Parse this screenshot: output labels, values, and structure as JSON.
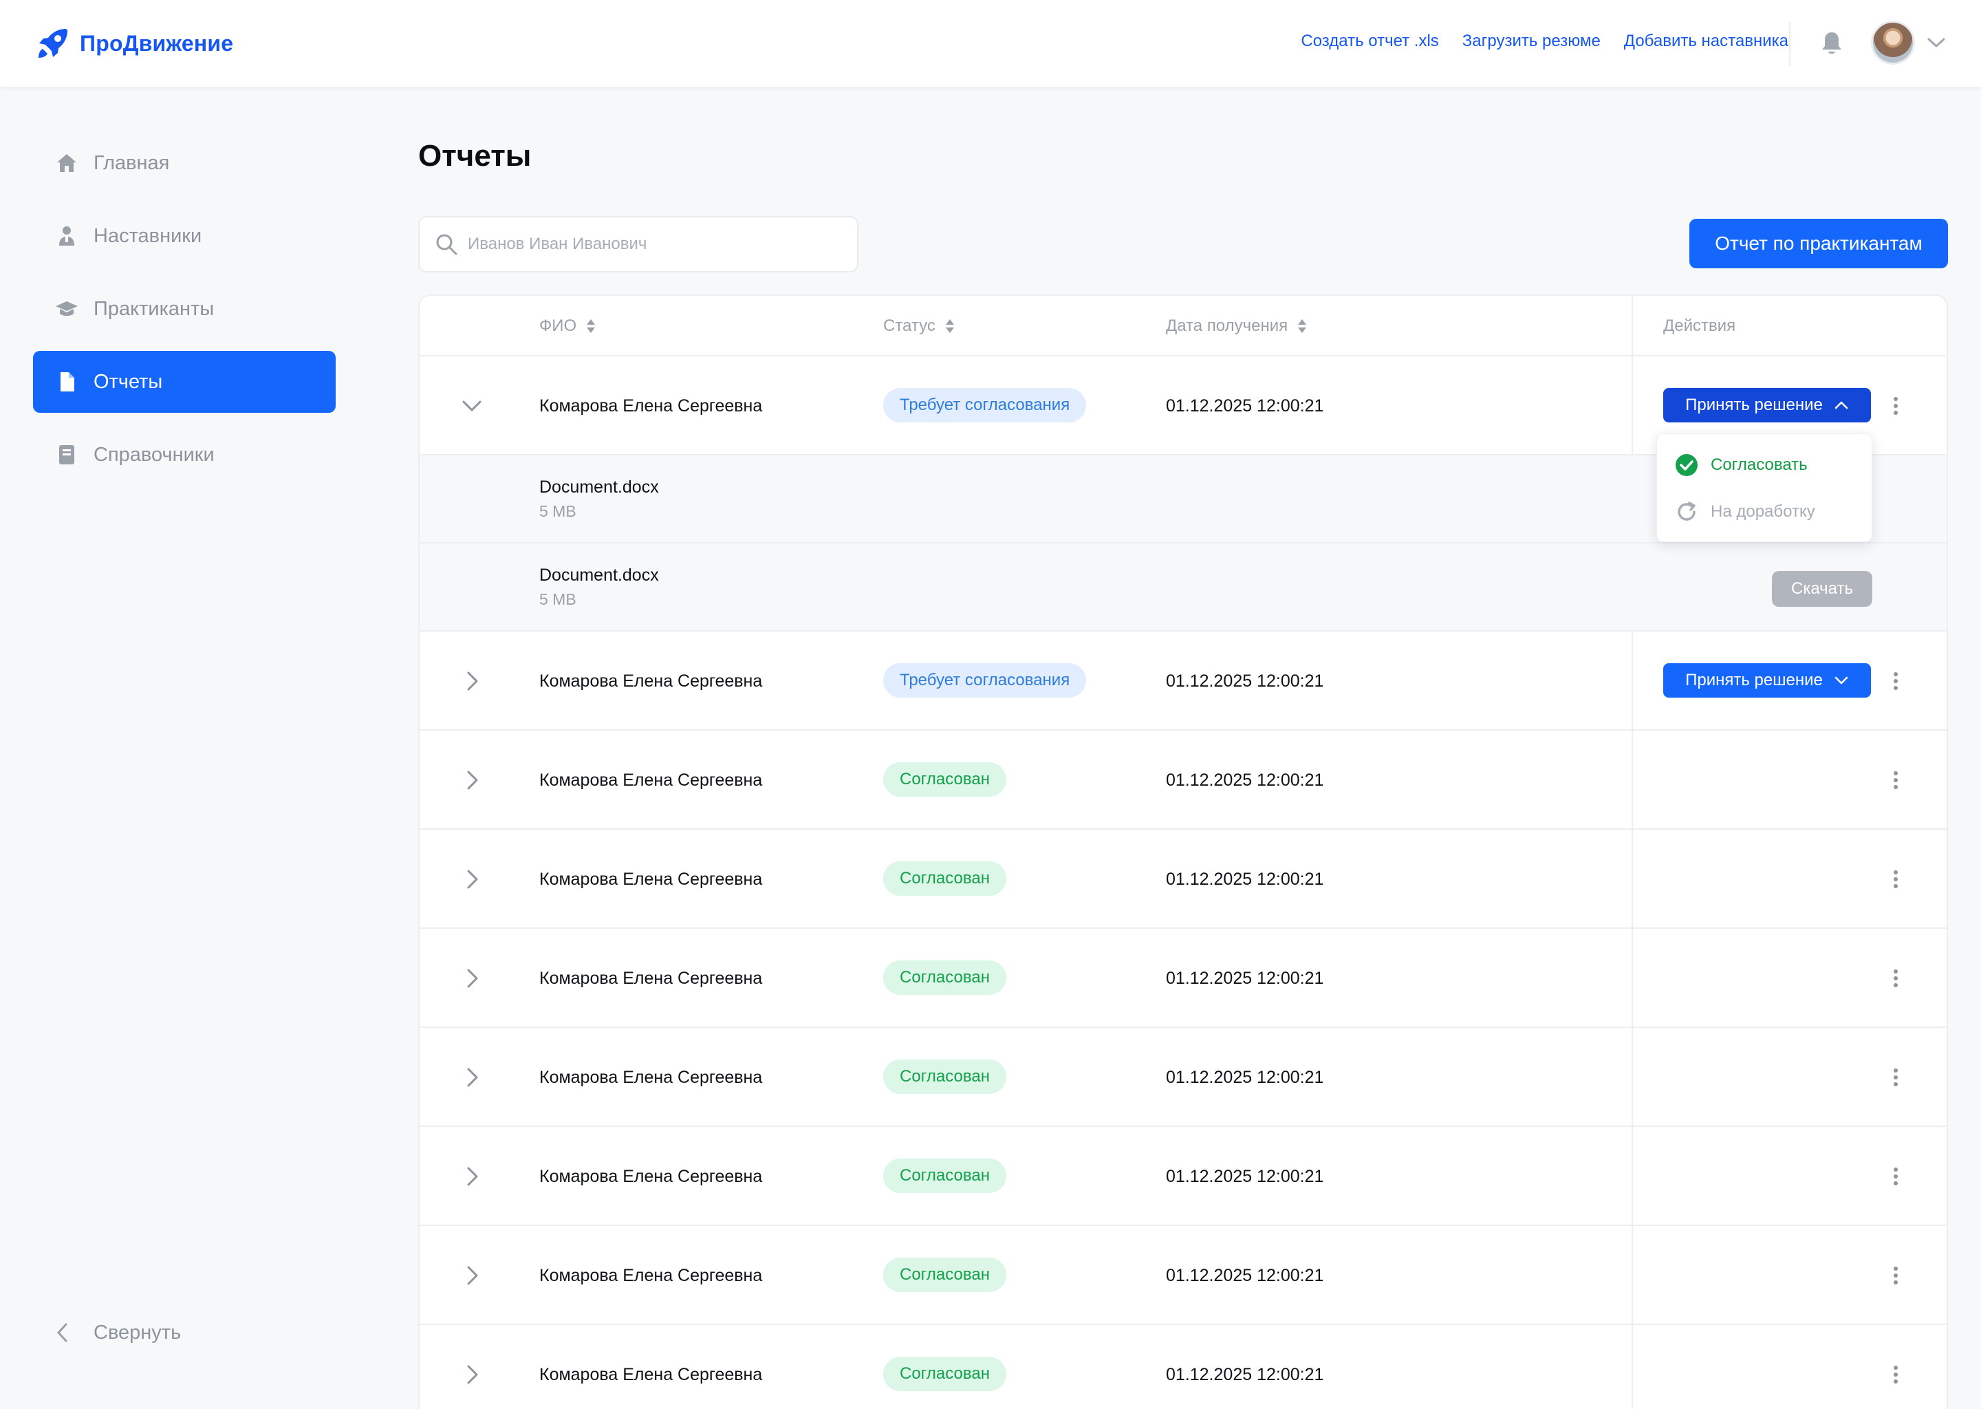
{
  "app": {
    "name": "ПроДвижение",
    "brand_color": "#1557f0",
    "accent_color": "#1567fb"
  },
  "header": {
    "links": [
      "Создать отчет .xls",
      "Загрузить резюме",
      "Добавить наставника"
    ],
    "icons": [
      "bell-icon",
      "avatar",
      "chevron-down-icon"
    ]
  },
  "sidebar": {
    "items": [
      {
        "label": "Главная",
        "icon": "home-icon",
        "active": false
      },
      {
        "label": "Наставники",
        "icon": "mentor-icon",
        "active": false
      },
      {
        "label": "Практиканты",
        "icon": "graduation-cap-icon",
        "active": false
      },
      {
        "label": "Отчеты",
        "icon": "document-icon",
        "active": true
      },
      {
        "label": "Справочники",
        "icon": "book-icon",
        "active": false
      }
    ],
    "collapse_label": "Свернуть"
  },
  "main": {
    "title": "Отчеты",
    "search": {
      "placeholder": "Иванов Иван Иванович",
      "value": ""
    },
    "report_button": "Отчет по практикантам"
  },
  "table": {
    "columns": {
      "name": "ФИО",
      "status": "Статус",
      "date": "Дата получения",
      "actions": "Действия"
    },
    "rows": [
      {
        "name": "Комарова Елена Сергеевна",
        "status": "Требует согласования",
        "status_type": "pending",
        "date": "01.12.2025 12:00:21",
        "action": "Принять решение",
        "expanded": true
      },
      {
        "name": "Комарова Елена Сергеевна",
        "status": "Требует согласования",
        "status_type": "pending",
        "date": "01.12.2025 12:00:21",
        "action": "Принять решение",
        "expanded": false
      },
      {
        "name": "Комарова Елена Сергеевна",
        "status": "Согласован",
        "status_type": "approved",
        "date": "01.12.2025 12:00:21",
        "action": "",
        "expanded": false
      },
      {
        "name": "Комарова Елена Сергеевна",
        "status": "Согласован",
        "status_type": "approved",
        "date": "01.12.2025 12:00:21",
        "action": "",
        "expanded": false
      },
      {
        "name": "Комарова Елена Сергеевна",
        "status": "Согласован",
        "status_type": "approved",
        "date": "01.12.2025 12:00:21",
        "action": "",
        "expanded": false
      },
      {
        "name": "Комарова Елена Сергеевна",
        "status": "Согласован",
        "status_type": "approved",
        "date": "01.12.2025 12:00:21",
        "action": "",
        "expanded": false
      },
      {
        "name": "Комарова Елена Сергеевна",
        "status": "Согласован",
        "status_type": "approved",
        "date": "01.12.2025 12:00:21",
        "action": "",
        "expanded": false
      },
      {
        "name": "Комарова Елена Сергеевна",
        "status": "Согласован",
        "status_type": "approved",
        "date": "01.12.2025 12:00:21",
        "action": "",
        "expanded": false
      },
      {
        "name": "Комарова Елена Сергеевна",
        "status": "Согласован",
        "status_type": "approved",
        "date": "01.12.2025 12:00:21",
        "action": "",
        "expanded": false
      }
    ],
    "files": [
      {
        "name": "Document.docx",
        "size": "5 MB"
      },
      {
        "name": "Document.docx",
        "size": "5 MB",
        "download_label": "Скачать"
      }
    ],
    "dropdown": {
      "approve": "Согласовать",
      "rework": "На доработку"
    }
  }
}
